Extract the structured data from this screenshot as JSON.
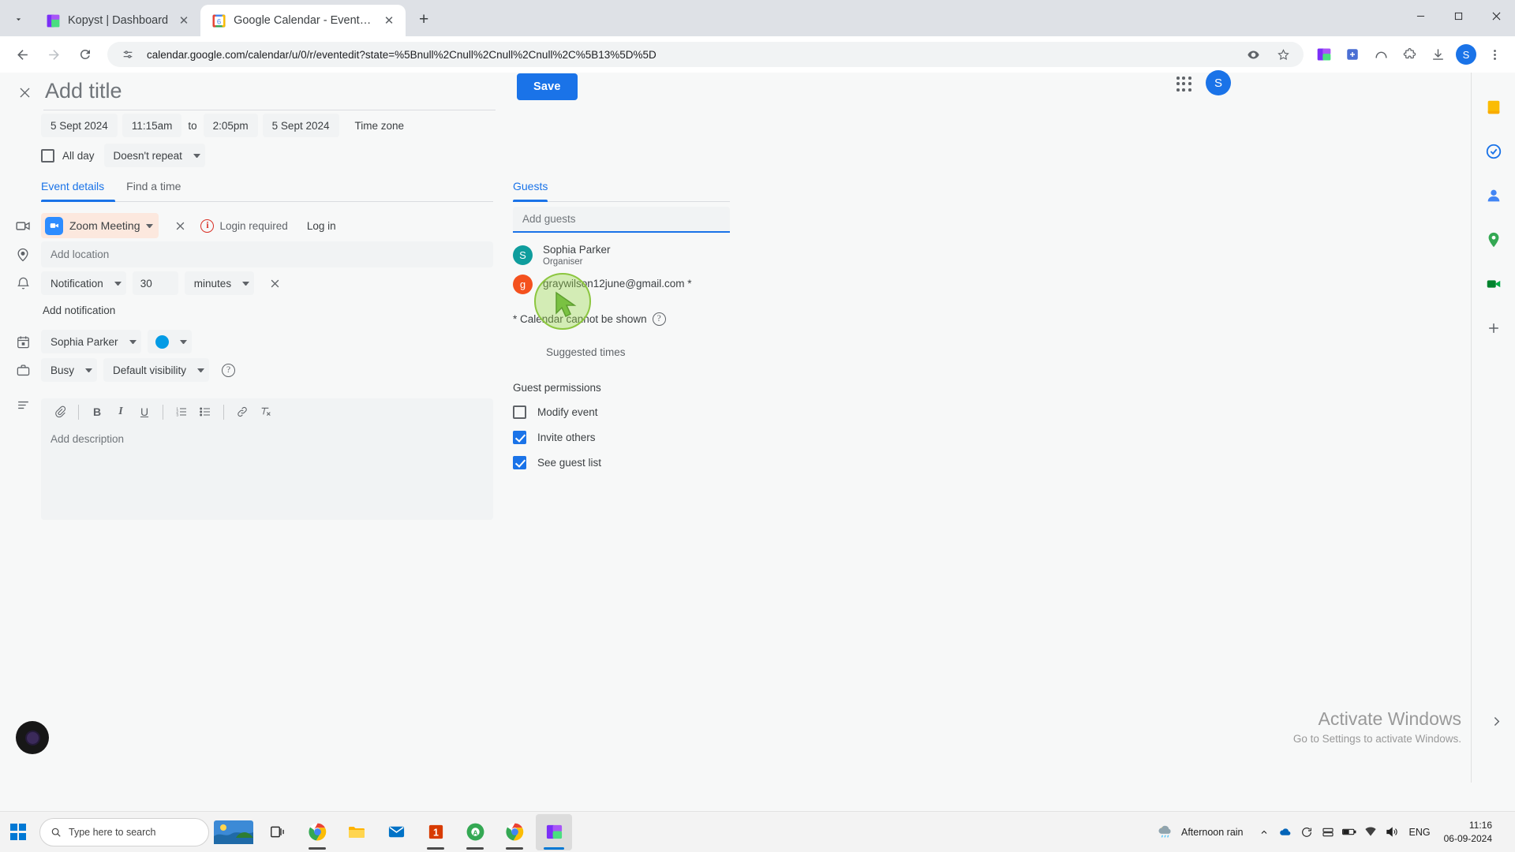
{
  "browser": {
    "tabs": [
      {
        "title": "Kopyst | Dashboard",
        "favicon": "kopyst-icon",
        "active": false
      },
      {
        "title": "Google Calendar - Event details",
        "favicon": "google-calendar-icon",
        "active": true
      }
    ],
    "new_tab_label": "+",
    "url": "calendar.google.com/calendar/u/0/r/eventedit?state=%5Bnull%2Cnull%2Cnull%2Cnull%2C%5B13%5D%5D",
    "window_controls": {
      "minimize": "—",
      "maximize": "☐",
      "close": "✕"
    },
    "profile_initial": "S",
    "accent": "#1a73e8"
  },
  "event": {
    "close_label": "✕",
    "title_placeholder": "Add title",
    "title_value": "",
    "save_label": "Save",
    "datetime": {
      "start_date": "5 Sept 2024",
      "start_time": "11:15am",
      "to_label": "to",
      "end_time": "2:05pm",
      "end_date": "5 Sept 2024",
      "timezone_label": "Time zone"
    },
    "all_day": {
      "label": "All day",
      "checked": false
    },
    "repeat": {
      "value": "Doesn't repeat"
    },
    "tabs": [
      {
        "label": "Event details",
        "active": true
      },
      {
        "label": "Find a time",
        "active": false
      }
    ],
    "conference": {
      "provider": "Zoom Meeting",
      "remove_label": "✕",
      "status": "Login required",
      "login_label": "Log in",
      "chip_bg": "#fce8de",
      "logo_color": "#2d8cff",
      "status_color": "#d93025"
    },
    "location": {
      "placeholder": "Add location",
      "value": ""
    },
    "notification": {
      "type": "Notification",
      "amount": "30",
      "unit": "minutes",
      "remove_label": "✕",
      "add_label": "Add notification"
    },
    "calendar": {
      "owner": "Sophia Parker",
      "color": "#039be5"
    },
    "availability": {
      "busy": "Busy",
      "visibility": "Default visibility"
    },
    "description": {
      "placeholder": "Add description",
      "value": "",
      "toolbar": [
        {
          "name": "attach-icon",
          "glyph": "📎"
        },
        {
          "name": "bold-icon",
          "glyph": "B"
        },
        {
          "name": "italic-icon",
          "glyph": "I"
        },
        {
          "name": "underline-icon",
          "glyph": "U"
        },
        {
          "name": "numbered-list-icon",
          "glyph": "≡"
        },
        {
          "name": "bulleted-list-icon",
          "glyph": "☰"
        },
        {
          "name": "link-icon",
          "glyph": "ὑ7"
        },
        {
          "name": "clear-formatting-icon",
          "glyph": "✕"
        }
      ]
    }
  },
  "guests": {
    "tab_label": "Guests",
    "add_placeholder": "Add guests",
    "add_value": "",
    "list": [
      {
        "initial": "S",
        "avatar_color": "#0f9d9d",
        "name": "Sophia Parker",
        "sub": "Organiser"
      },
      {
        "initial": "g",
        "avatar_color": "#f4511e",
        "name": "graywilson12june@gmail.com *",
        "sub": ""
      }
    ],
    "calendar_note": "* Calendar cannot be shown",
    "calendar_note_help": "?",
    "suggested_times_label": "Suggested times",
    "permissions_title": "Guest permissions",
    "permissions": [
      {
        "label": "Modify event",
        "checked": false
      },
      {
        "label": "Invite others",
        "checked": true
      },
      {
        "label": "See guest list",
        "checked": true
      }
    ]
  },
  "rail": {
    "icons": [
      "keep-icon",
      "tasks-icon",
      "contacts-icon",
      "maps-icon",
      "meet-icon",
      "add-apps-icon"
    ],
    "expand_label": "›"
  },
  "watermark": {
    "line1": "Activate Windows",
    "line2": "Go to Settings to activate Windows."
  },
  "taskbar": {
    "search_placeholder": "Type here to search",
    "weather": "Afternoon rain",
    "language": "ENG",
    "time": "11:16",
    "date": "06-09-2024",
    "apps": [
      {
        "name": "taskview-icon"
      },
      {
        "name": "chrome-icon"
      },
      {
        "name": "file-explorer-icon"
      },
      {
        "name": "mail-icon"
      },
      {
        "name": "office-icon"
      },
      {
        "name": "chrome-green-icon"
      },
      {
        "name": "chrome-window-icon"
      },
      {
        "name": "kopyst-icon"
      }
    ]
  }
}
